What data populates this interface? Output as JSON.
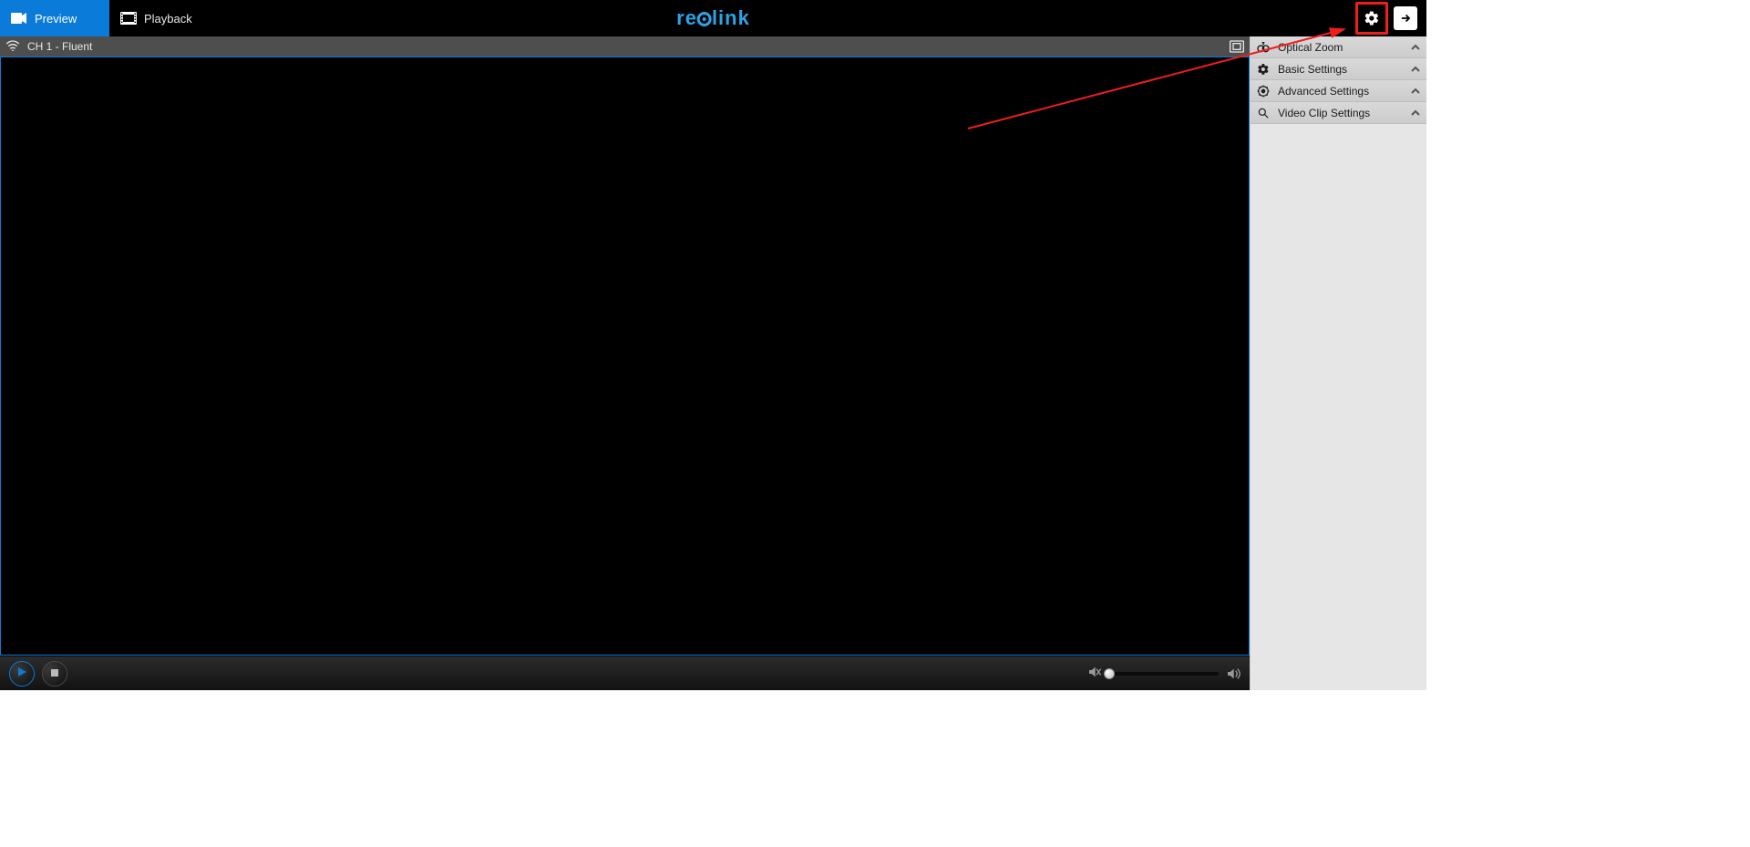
{
  "topbar": {
    "tabs": {
      "preview": {
        "label": "Preview"
      },
      "playback": {
        "label": "Playback"
      }
    },
    "brand_text_left": "re",
    "brand_text_right": "link"
  },
  "channel": {
    "label": "CH 1 - Fluent"
  },
  "sidebar": {
    "items": [
      {
        "label": "Optical Zoom"
      },
      {
        "label": "Basic Settings"
      },
      {
        "label": "Advanced Settings"
      },
      {
        "label": "Video Clip Settings"
      }
    ]
  },
  "colors": {
    "accent": "#0a7bd8",
    "brand": "#2aa4e6",
    "highlight": "#f01d1d"
  }
}
